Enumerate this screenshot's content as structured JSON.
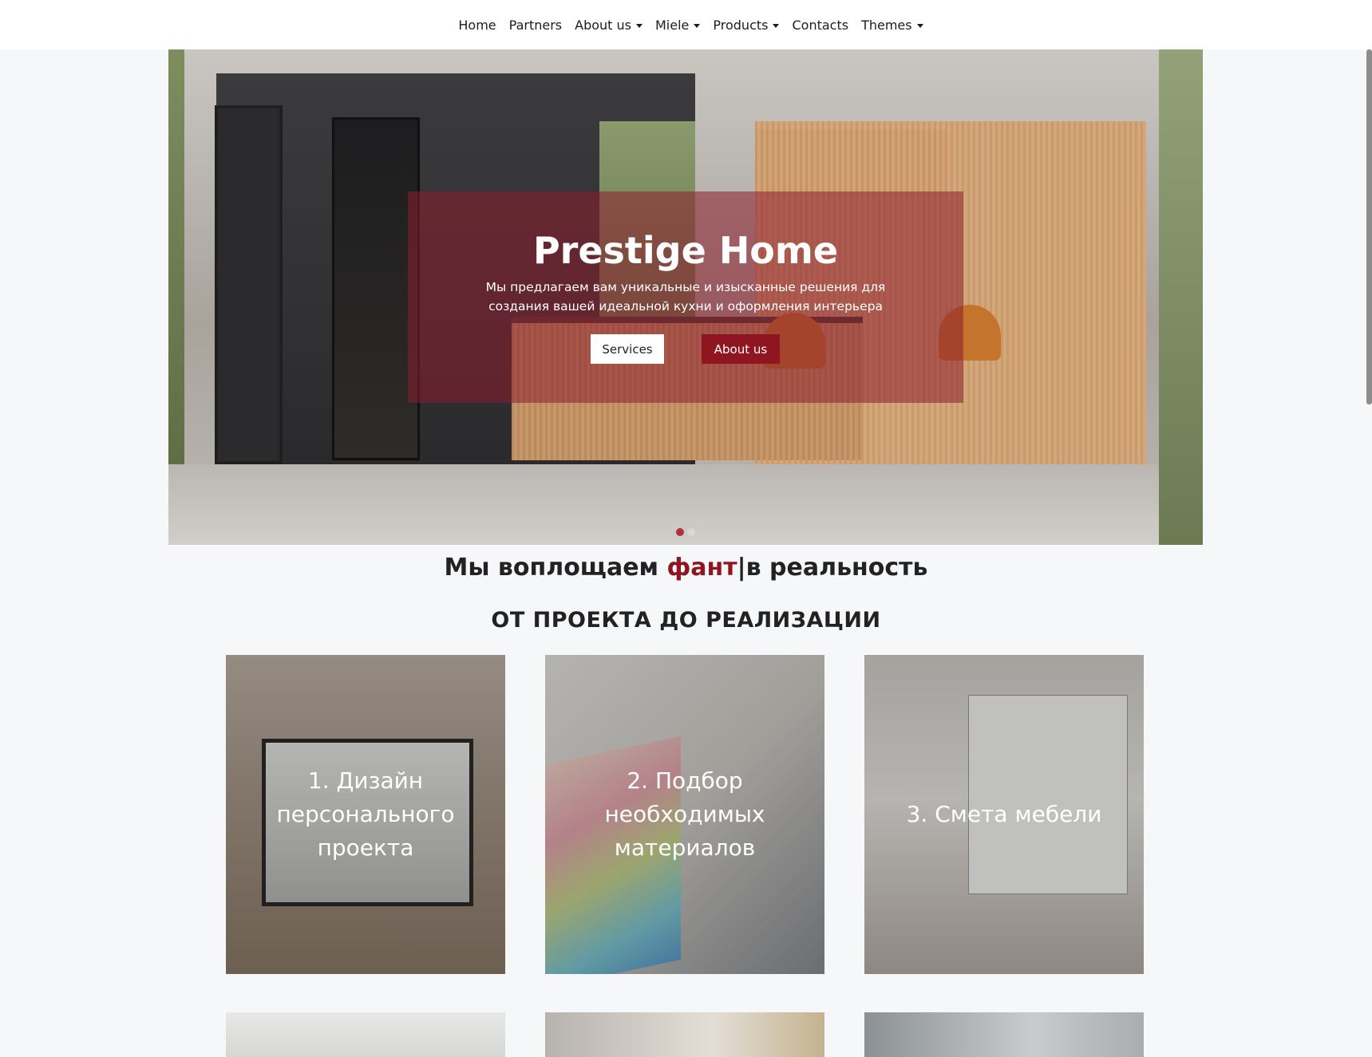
{
  "nav": {
    "items": [
      {
        "label": "Home",
        "dropdown": false
      },
      {
        "label": "Partners",
        "dropdown": false
      },
      {
        "label": "About us",
        "dropdown": true
      },
      {
        "label": "Miele",
        "dropdown": true
      },
      {
        "label": "Products",
        "dropdown": true
      },
      {
        "label": "Contacts",
        "dropdown": false
      },
      {
        "label": "Themes",
        "dropdown": true
      }
    ]
  },
  "hero": {
    "title": "Prestige Home",
    "subtitle": "Мы предлагаем вам уникальные и изысканные решения для создания вашей идеальной кухни и оформления интерьера",
    "services_label": "Services",
    "about_label": "About us",
    "slides_total": 2,
    "active_slide": 1
  },
  "tagline": {
    "before": "Мы воплощаем ",
    "accent": "фант",
    "after": "|в реальность"
  },
  "section": {
    "title": "ОТ ПРОЕКТА ДО РЕАЛИЗАЦИИ"
  },
  "cards": [
    {
      "lines": [
        "1. Дизайн",
        "персонального",
        "проекта"
      ]
    },
    {
      "lines": [
        "2. Подбор",
        "необходимых",
        "материалов"
      ]
    },
    {
      "lines": [
        "3. Смета мебели"
      ]
    }
  ],
  "colors": {
    "accent": "#8f1521",
    "overlay": "#8c1e2d",
    "background": "#f6f7f9"
  }
}
